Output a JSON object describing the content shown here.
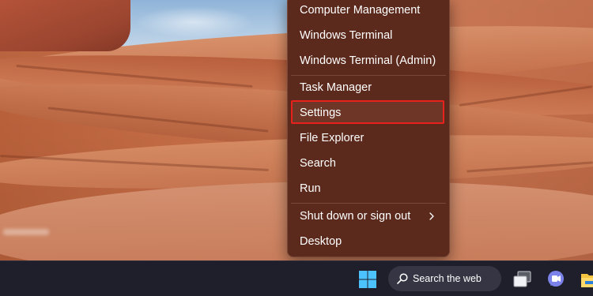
{
  "context_menu": {
    "items": [
      {
        "label": "Computer Management"
      },
      {
        "label": "Windows Terminal"
      },
      {
        "label": "Windows Terminal (Admin)"
      },
      {
        "label": "Task Manager"
      },
      {
        "label": "Settings",
        "highlighted": true
      },
      {
        "label": "File Explorer"
      },
      {
        "label": "Search"
      },
      {
        "label": "Run"
      },
      {
        "label": "Shut down or sign out",
        "has_submenu": true
      },
      {
        "label": "Desktop"
      }
    ]
  },
  "taskbar": {
    "search_label": "Search the web",
    "icons": [
      "windows-start-icon",
      "search-icon",
      "task-view-icon",
      "teams-chat-icon",
      "file-explorer-icon"
    ]
  },
  "colors": {
    "menu_background": "#5c2a1c",
    "highlight_border": "#e8211c",
    "taskbar_background": "#1f1f2b"
  }
}
